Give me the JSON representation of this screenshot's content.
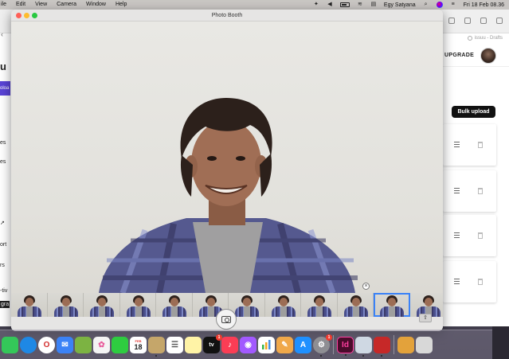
{
  "menubar": {
    "app_menu": "ile",
    "items": [
      "Edit",
      "View",
      "Camera",
      "Window",
      "Help"
    ],
    "user": "Egy Satyana",
    "datetime": "Fri 18 Feb 08.36"
  },
  "photobooth": {
    "title": "Photo Booth",
    "thumbnails_count": 12,
    "selected_thumbnail": 11
  },
  "browser": {
    "url_text": "issuu - Drafts",
    "upgrade_label": "UPGRADE",
    "bulk_upload_label": "Bulk upload",
    "left_labels": {
      "upload": "oloa",
      "item1": "es",
      "item2": "es",
      "item3": "ort",
      "item4": "rs",
      "item5": "-tiv",
      "item6": "gra"
    }
  },
  "dock": {
    "calendar_date": "18",
    "calendar_month": "FEB",
    "appletv_label": "tv",
    "indesign_label": "Id",
    "badges": {
      "appletv": "1",
      "settings": "1"
    },
    "bottom_label": "",
    "icons": [
      {
        "name": "messages-icon",
        "color": "#34c759",
        "glyph": ""
      },
      {
        "name": "safari-icon",
        "color": "#1e88e5",
        "glyph": ""
      },
      {
        "name": "opera-icon",
        "color": "#d32f2f",
        "glyph": "O"
      },
      {
        "name": "mail-icon",
        "color": "#3b82f6",
        "glyph": "✉"
      },
      {
        "name": "maps-icon",
        "color": "#7cb342",
        "glyph": ""
      },
      {
        "name": "photos-icon",
        "color": "#f4f4f4",
        "glyph": "✿"
      },
      {
        "name": "facetime-icon",
        "color": "#2ecc40",
        "glyph": ""
      },
      {
        "name": "calendar-icon",
        "color": "#ffffff",
        "glyph": ""
      },
      {
        "name": "finder-brown-icon",
        "color": "#c5a66a",
        "glyph": ""
      },
      {
        "name": "reminders-icon",
        "color": "#ffffff",
        "glyph": "☰"
      },
      {
        "name": "notes-icon",
        "color": "#fff3a6",
        "glyph": ""
      },
      {
        "name": "appletv-icon",
        "color": "#111111",
        "glyph": ""
      },
      {
        "name": "music-icon",
        "color": "#fa3d55",
        "glyph": "♪"
      },
      {
        "name": "podcasts-icon",
        "color": "#a259ff",
        "glyph": "◉"
      },
      {
        "name": "numbers-icon",
        "color": "#ffffff",
        "glyph": ""
      },
      {
        "name": "pages-icon",
        "color": "#f0a84a",
        "glyph": "✎"
      },
      {
        "name": "appstore-icon",
        "color": "#1e90ff",
        "glyph": "A"
      },
      {
        "name": "system-preferences-icon",
        "color": "#8e8e93",
        "glyph": "⚙"
      },
      {
        "name": "indesign-icon",
        "color": "#4a0b2b",
        "glyph": ""
      },
      {
        "name": "preview-icon",
        "color": "#cfd8e3",
        "glyph": ""
      },
      {
        "name": "acrobat-icon",
        "color": "#c62828",
        "glyph": ""
      },
      {
        "name": "folder-icon",
        "color": "#e3a23b",
        "glyph": ""
      },
      {
        "name": "trash-icon",
        "color": "#d8d8d8",
        "glyph": ""
      }
    ]
  },
  "colors": {
    "accent_blue": "#3a82f7",
    "menubar_bg": "#c9c6c3",
    "bulk_upload_bg": "#111111",
    "sidebar_purple": "#5a44d6"
  }
}
